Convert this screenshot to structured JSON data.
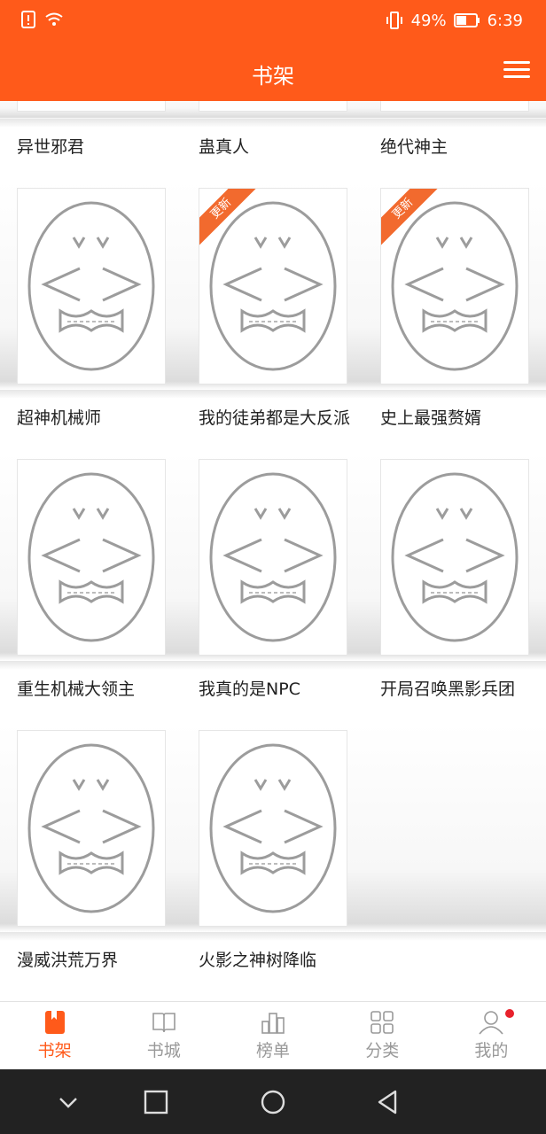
{
  "status": {
    "battery_text": "49%",
    "time": "6:39"
  },
  "header": {
    "title": "书架"
  },
  "books": [
    {
      "title": "异世邪君",
      "updated": false
    },
    {
      "title": "蛊真人",
      "updated": false
    },
    {
      "title": "绝代神主",
      "updated": false
    },
    {
      "title": "超神机械师",
      "updated": false
    },
    {
      "title": "我的徒弟都是大反派",
      "updated": true
    },
    {
      "title": "史上最强赘婿",
      "updated": true
    },
    {
      "title": "重生机械大领主",
      "updated": false
    },
    {
      "title": "我真的是NPC",
      "updated": false
    },
    {
      "title": "开局召唤黑影兵团",
      "updated": false
    },
    {
      "title": "漫威洪荒万界",
      "updated": false
    },
    {
      "title": "火影之神树降临",
      "updated": false
    }
  ],
  "badge_text": "更新",
  "bottom_nav": [
    {
      "label": "书架",
      "icon": "bookmark-icon",
      "active": true
    },
    {
      "label": "书城",
      "icon": "book-icon",
      "active": false
    },
    {
      "label": "榜单",
      "icon": "bar-chart-icon",
      "active": false
    },
    {
      "label": "分类",
      "icon": "grid-icon",
      "active": false
    },
    {
      "label": "我的",
      "icon": "user-icon",
      "active": false,
      "notification": true
    }
  ],
  "colors": {
    "brand": "#ff5a1a",
    "badge": "#f26a2e",
    "notification": "#e8212c"
  }
}
